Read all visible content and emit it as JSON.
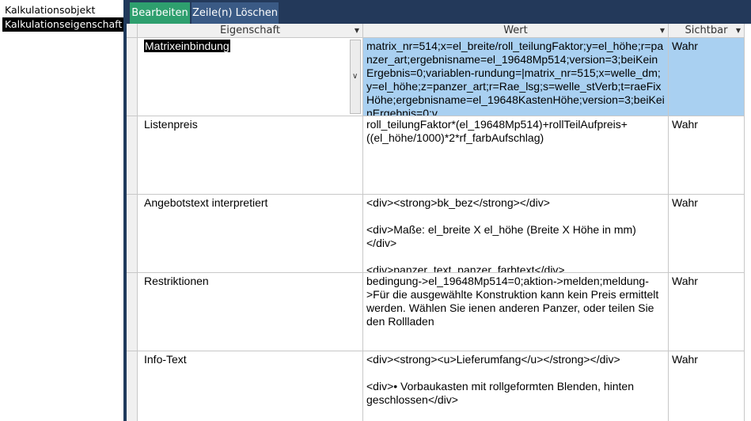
{
  "nav": {
    "items": [
      {
        "label": "Kalkulationsobjekt"
      },
      {
        "label": "Kalkulationseigenschaft"
      }
    ]
  },
  "toolbar": {
    "edit_label": "Bearbeiten",
    "delete_label": "Zeile(n) Löschen"
  },
  "grid": {
    "columns": {
      "eigenschaft": "Eigenschaft",
      "wert": "Wert",
      "sichtbar": "Sichtbar"
    },
    "rows": [
      {
        "eigenschaft": "Matrixeinbindung",
        "wert": "matrix_nr=514;x=el_breite/roll_teilungFaktor;y=el_höhe;r=panzer_art;ergebnisname=el_19648Mp514;version=3;beiKeinErgebnis=0;variablen-rundung=|matrix_nr=515;x=welle_dm;y=el_höhe;z=panzer_art;r=Rae_lsg;s=welle_stVerb;t=raeFixHöhe;ergebnisname=el_19648KastenHöhe;version=3;beiKeinErgebnis=0;v",
        "sichtbar": "Wahr"
      },
      {
        "eigenschaft": "Listenpreis",
        "wert": "roll_teilungFaktor*(el_19648Mp514)+rollTeilAufpreis+((el_höhe/1000)*2*rf_farbAufschlag)",
        "sichtbar": "Wahr"
      },
      {
        "eigenschaft": "Angebotstext interpretiert",
        "wert": "<div><strong>bk_bez</strong></div>\n\n<div>Maße: el_breite X el_höhe (Breite X Höhe in mm)</div>\n\n<div>panzer_text, panzer_farbtext</div>",
        "sichtbar": "Wahr"
      },
      {
        "eigenschaft": "Restriktionen",
        "wert": "bedingung->el_19648Mp514=0;aktion->melden;meldung->Für die ausgewählte Konstruktion kann kein Preis ermittelt werden. Wählen Sie ienen anderen Panzer, oder teilen Sie den Rollladen",
        "sichtbar": "Wahr"
      },
      {
        "eigenschaft": "Info-Text",
        "wert": "<div><strong><u>Lieferumfang</u></strong></div>\n\n<div>• Vorbaukasten mit rollgeformten Blenden, hinten geschlossen</div>",
        "sichtbar": "Wahr"
      }
    ]
  },
  "colors": {
    "toolbar_bg": "#23395a",
    "edit_button": "#2e9f6e",
    "delete_button": "#3a5a85",
    "selected_row": "#a9d0f1"
  }
}
